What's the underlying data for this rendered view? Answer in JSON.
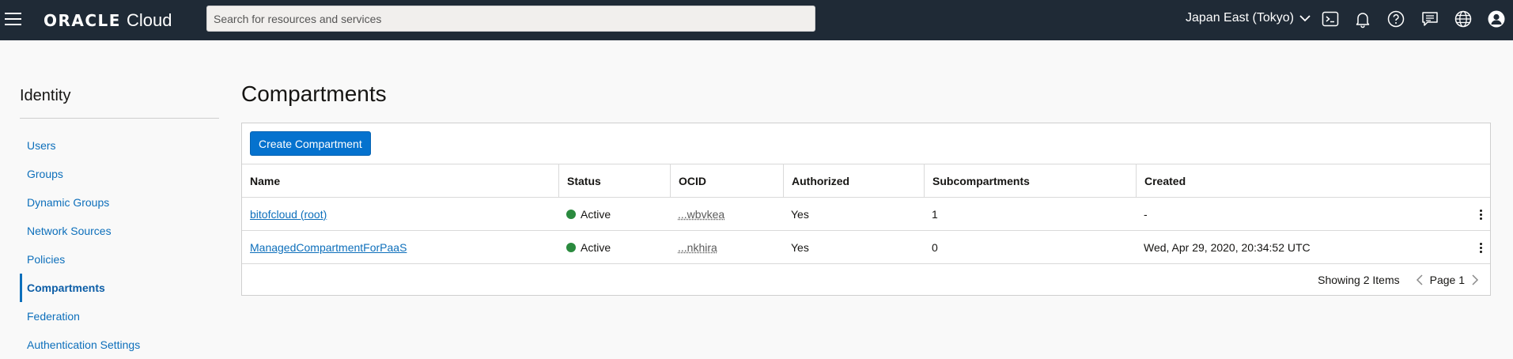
{
  "header": {
    "brand": "ORACLE",
    "product": "Cloud",
    "search_placeholder": "Search for resources and services",
    "region": "Japan East (Tokyo)",
    "icons": [
      "menu-icon",
      "chevron-down-icon",
      "cloud-shell-icon",
      "bell-icon",
      "help-icon",
      "chat-icon",
      "globe-icon",
      "user-icon"
    ]
  },
  "sidebar": {
    "title": "Identity",
    "items": [
      {
        "label": "Users"
      },
      {
        "label": "Groups"
      },
      {
        "label": "Dynamic Groups"
      },
      {
        "label": "Network Sources"
      },
      {
        "label": "Policies"
      },
      {
        "label": "Compartments",
        "active": true
      },
      {
        "label": "Federation"
      },
      {
        "label": "Authentication Settings"
      }
    ]
  },
  "main": {
    "title": "Compartments",
    "create_button": "Create Compartment",
    "columns": [
      "Name",
      "Status",
      "OCID",
      "Authorized",
      "Subcompartments",
      "Created"
    ],
    "rows": [
      {
        "name": "bitofcloud (root)",
        "status": "Active",
        "ocid": "...wbvkea",
        "authorized": "Yes",
        "subcompartments": "1",
        "created": "-"
      },
      {
        "name": "ManagedCompartmentForPaaS",
        "status": "Active",
        "ocid": "...nkhira",
        "authorized": "Yes",
        "subcompartments": "0",
        "created": "Wed, Apr 29, 2020, 20:34:52 UTC"
      }
    ],
    "footer": {
      "count": "Showing 2 Items",
      "page": "Page 1"
    }
  },
  "colors": {
    "topbar": "#1f2a36",
    "link": "#0d6fbb",
    "button": "#0572ce",
    "status_active": "#2a8a3e"
  }
}
